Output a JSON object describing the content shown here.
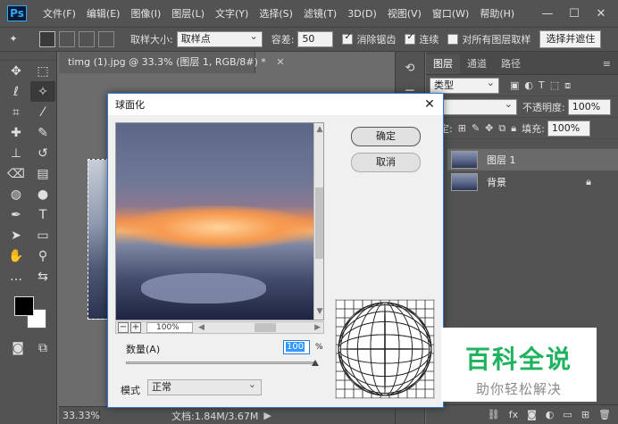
{
  "app": {
    "logo": "Ps",
    "menu": [
      "文件(F)",
      "编辑(E)",
      "图像(I)",
      "图层(L)",
      "文字(Y)",
      "选择(S)",
      "滤镜(T)",
      "3D(D)",
      "视图(V)",
      "窗口(W)",
      "帮助(H)"
    ],
    "window_controls": {
      "minimize": "—",
      "maximize": "☐",
      "close": "✕"
    }
  },
  "options": {
    "sample_size_label": "取样大小:",
    "sample_size_value": "取样点",
    "tolerance_label": "容差:",
    "tolerance_value": "50",
    "antialias_label": "消除锯齿",
    "antialias_checked": true,
    "contiguous_label": "连续",
    "contiguous_checked": true,
    "sample_all_label": "对所有图层取样",
    "sample_all_checked": false,
    "select_subject_label": "选择并遮住"
  },
  "document": {
    "tab_title": "timg (1).jpg @ 33.3% (图层 1, RGB/8#) *",
    "tab_close": "✕"
  },
  "status": {
    "zoom": "33.33%",
    "doc_info": "文档:1.84M/3.67M",
    "arrow": "▶"
  },
  "layers_panel": {
    "tabs": [
      "图层",
      "通道",
      "路径"
    ],
    "kind_label": "类型",
    "blend_mode": "常",
    "opacity_label": "不透明度:",
    "opacity_value": "100%",
    "lock_label": "锁定:",
    "fill_label": "填充:",
    "fill_value": "100%",
    "layers": [
      {
        "name": "图层 1",
        "selected": true,
        "locked": false
      },
      {
        "name": "背景",
        "selected": false,
        "locked": true
      }
    ],
    "footer_fx": "fx"
  },
  "dialog": {
    "title": "球面化",
    "ok_label": "确定",
    "cancel_label": "取消",
    "zoom_value": "100%",
    "amount_label": "数量(A)",
    "amount_value": "100",
    "amount_unit": "%",
    "amount_fraction": 1.0,
    "mode_label": "模式",
    "mode_value": "正常"
  },
  "watermark": {
    "title": "百科全说",
    "subtitle": "助你轻松解决"
  },
  "colors": {
    "accent_blue": "#2b78d8",
    "watermark_green": "#1fb35f"
  }
}
